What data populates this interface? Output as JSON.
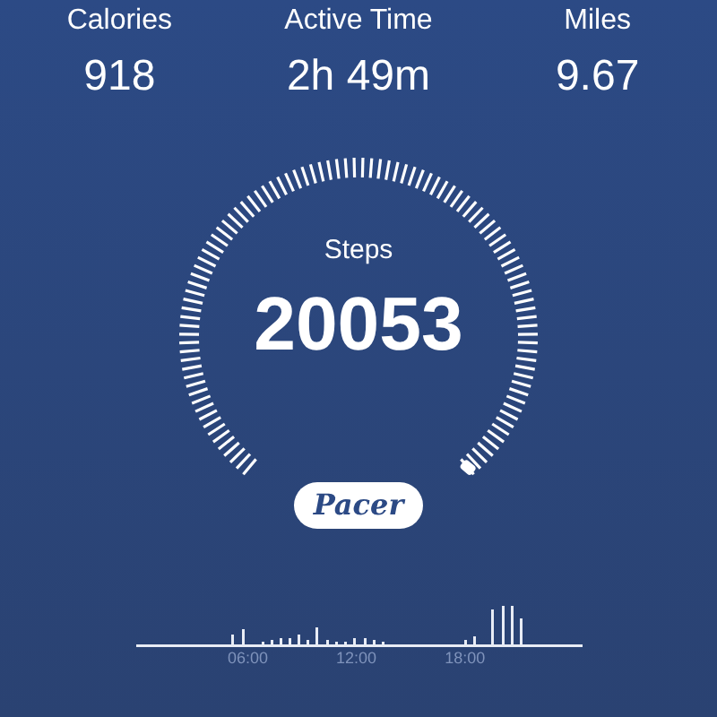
{
  "stats": [
    {
      "label": "Calories",
      "value": "918"
    },
    {
      "label": "Active Time",
      "value": "2h 49m"
    },
    {
      "label": "Miles",
      "value": "9.67"
    }
  ],
  "gauge": {
    "label": "Steps",
    "value": "20053"
  },
  "brand_button": {
    "label": "Pacer"
  },
  "activity_chart": {
    "time_labels": [
      "06:00",
      "12:00",
      "18:00"
    ]
  }
}
